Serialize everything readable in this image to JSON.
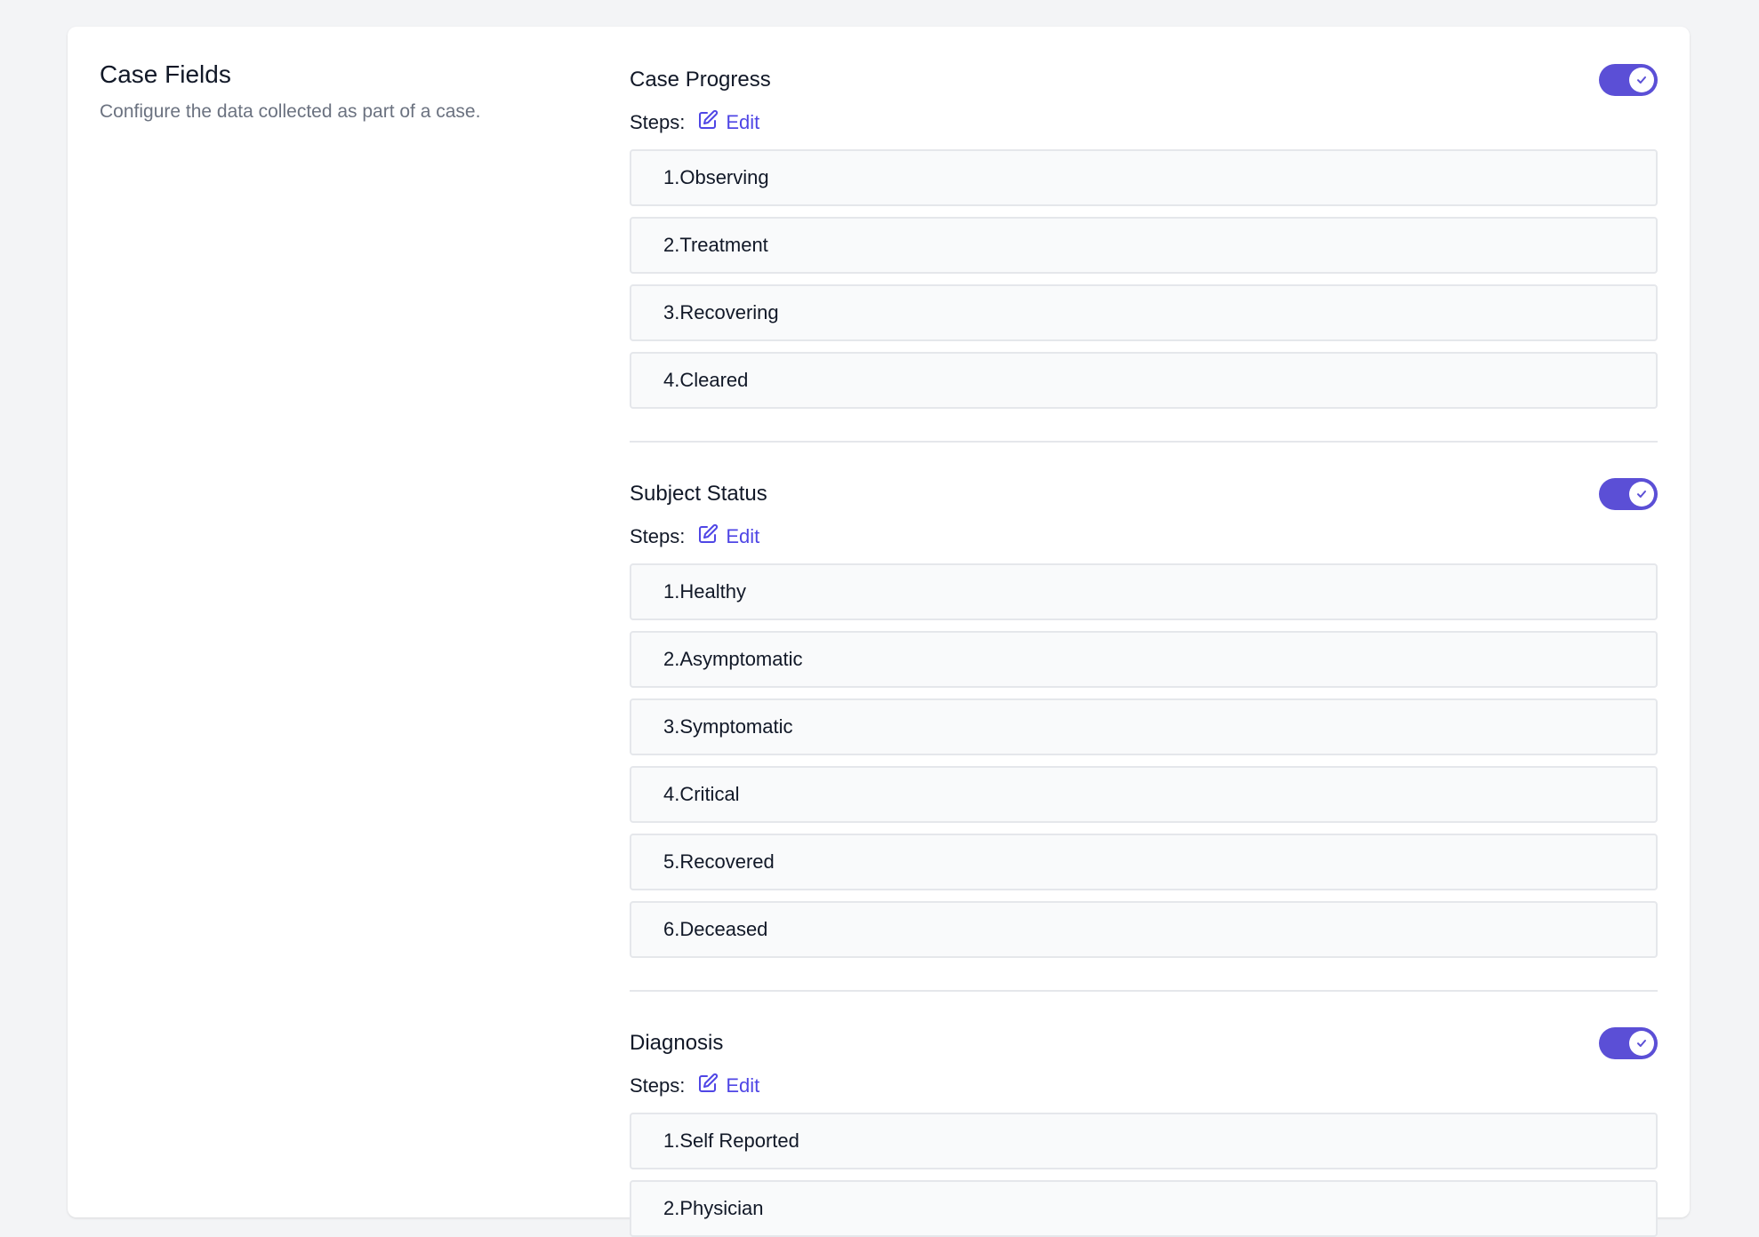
{
  "panel": {
    "title": "Case Fields",
    "subtitle": "Configure the data collected as part of a case."
  },
  "colors": {
    "accent": "#5b4fd6",
    "link": "#4f46e5"
  },
  "sections": [
    {
      "title": "Case Progress",
      "enabled": true,
      "steps_label": "Steps:",
      "edit_label": "Edit",
      "steps": [
        "1.Observing",
        "2.Treatment",
        "3.Recovering",
        "4.Cleared"
      ]
    },
    {
      "title": "Subject Status",
      "enabled": true,
      "steps_label": "Steps:",
      "edit_label": "Edit",
      "steps": [
        "1.Healthy",
        "2.Asymptomatic",
        "3.Symptomatic",
        "4.Critical",
        "5.Recovered",
        "6.Deceased"
      ]
    },
    {
      "title": "Diagnosis",
      "enabled": true,
      "steps_label": "Steps:",
      "edit_label": "Edit",
      "steps": [
        "1.Self Reported",
        "2.Physician"
      ]
    }
  ]
}
